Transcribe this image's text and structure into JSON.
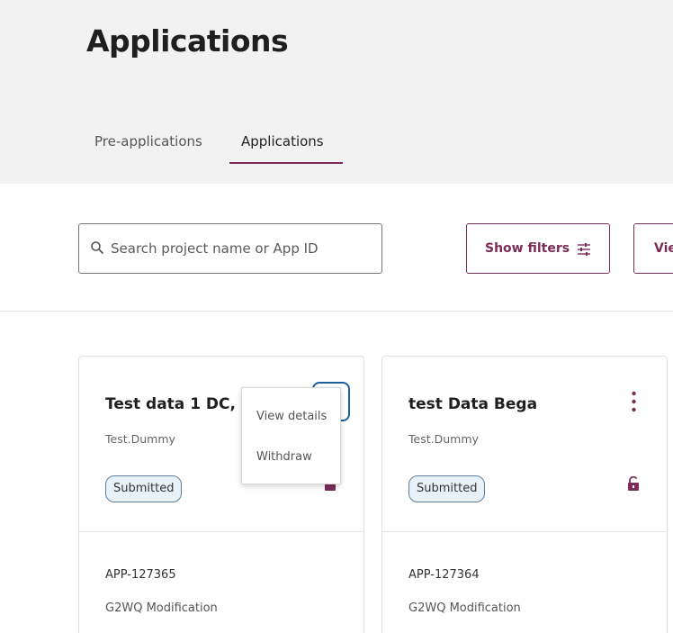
{
  "page": {
    "title": "Applications"
  },
  "tabs": [
    {
      "label": "Pre-applications",
      "active": false
    },
    {
      "label": "Applications",
      "active": true
    }
  ],
  "toolbar": {
    "search_placeholder": "Search project name or App ID",
    "show_filters_label": "Show filters",
    "view_label": "Vie"
  },
  "cards": [
    {
      "title": "Test data 1 DC, O",
      "owner": "Test.Dummy",
      "status": "Submitted",
      "app_id": "APP-127365",
      "type": "G2WQ Modification"
    },
    {
      "title": "test Data Bega",
      "owner": "Test.Dummy",
      "status": "Submitted",
      "app_id": "APP-127364",
      "type": "G2WQ Modification"
    }
  ],
  "context_menu": {
    "items": [
      "View details",
      "Withdraw"
    ]
  },
  "colors": {
    "accent": "#7b2d57",
    "badge_bg": "#e8f1f8",
    "badge_border": "#5c7e9a",
    "focus": "#1f5f9e"
  }
}
